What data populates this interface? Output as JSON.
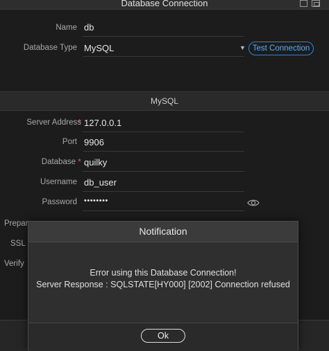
{
  "window": {
    "title": "Database Connection"
  },
  "form": {
    "name_label": "Name",
    "name_value": "db",
    "type_label": "Database Type",
    "type_value": "MySQL",
    "test_button": "Test Connection"
  },
  "section": {
    "title": "MySQL"
  },
  "mysql": {
    "server_label": "Server Address",
    "server_value": "127.0.0.1",
    "port_label": "Port",
    "port_value": "9906",
    "database_label": "Database",
    "database_value": "quilky",
    "username_label": "Username",
    "username_value": "db_user",
    "password_label": "Password",
    "password_value": "••••••••",
    "required_mark": "*"
  },
  "hidden_labels": {
    "prepared": "Prepar",
    "ssl": "SSL",
    "verify": "Verify"
  },
  "notification": {
    "title": "Notification",
    "line1": "Error using this Database Connection!",
    "line2": "Server Response : SQLSTATE[HY000] [2002] Connection refused",
    "ok_label": "Ok"
  },
  "colors": {
    "accent": "#2f86d6",
    "required": "#d9534f",
    "background": "#1c1c1c"
  },
  "icons": {
    "password_toggle": "eye-icon"
  }
}
